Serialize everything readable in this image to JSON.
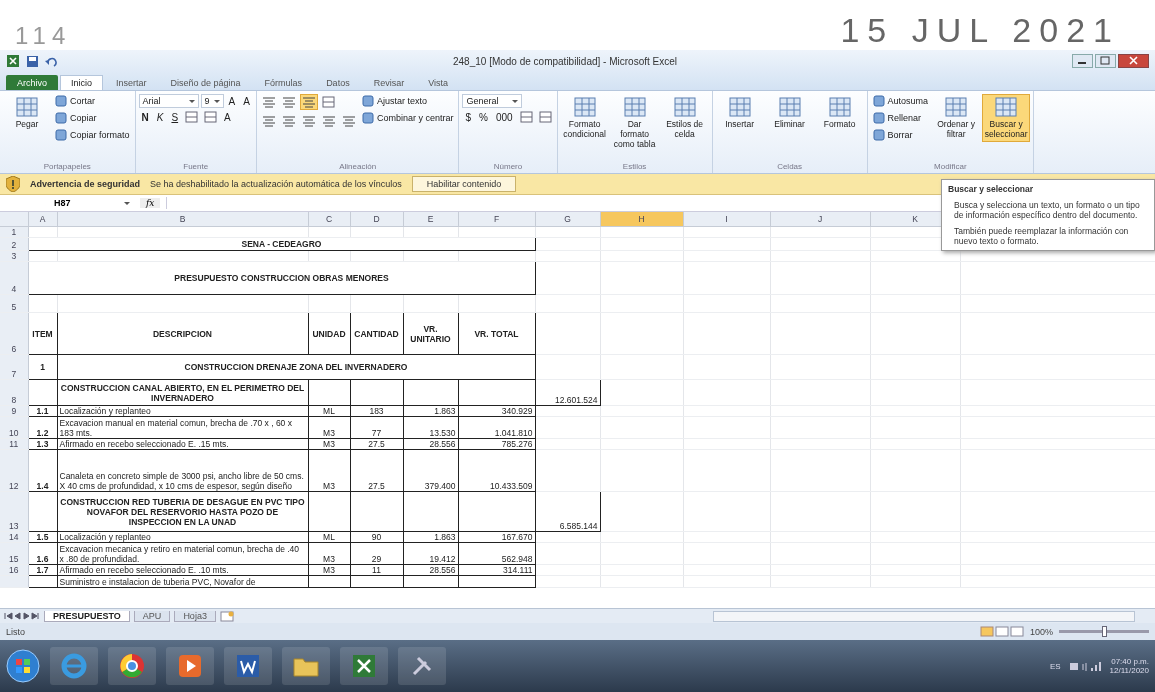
{
  "stamp": {
    "page_number": "114",
    "date": "15 JUL 2021"
  },
  "window": {
    "title": "248_10 [Modo de compatibilidad] - Microsoft Excel"
  },
  "ribbon_tabs": [
    {
      "label": "Archivo",
      "kind": "file",
      "selected": false
    },
    {
      "label": "Inicio",
      "kind": "tab",
      "selected": true
    },
    {
      "label": "Insertar",
      "kind": "tab",
      "selected": false
    },
    {
      "label": "Diseño de página",
      "kind": "tab",
      "selected": false
    },
    {
      "label": "Fórmulas",
      "kind": "tab",
      "selected": false
    },
    {
      "label": "Datos",
      "kind": "tab",
      "selected": false
    },
    {
      "label": "Revisar",
      "kind": "tab",
      "selected": false
    },
    {
      "label": "Vista",
      "kind": "tab",
      "selected": false
    }
  ],
  "ribbon_groups": [
    {
      "label": "Portapapeles",
      "columns": [
        [
          {
            "kind": "large",
            "label": "Pegar",
            "on": false
          }
        ],
        [
          {
            "kind": "small",
            "label": "Cortar"
          },
          {
            "kind": "small",
            "label": "Copiar"
          },
          {
            "kind": "small",
            "label": "Copiar formato"
          }
        ]
      ]
    },
    {
      "label": "Fuente",
      "columns": [
        [
          {
            "kind": "row",
            "items": [
              {
                "kind": "field",
                "label": "Arial"
              },
              {
                "kind": "field",
                "label": "9"
              },
              {
                "kind": "glyph",
                "label": "A"
              },
              {
                "kind": "glyph",
                "label": "A"
              }
            ]
          },
          {
            "kind": "row",
            "items": [
              {
                "kind": "bold",
                "label": "N"
              },
              {
                "kind": "italic",
                "label": "K"
              },
              {
                "kind": "underline",
                "label": "S"
              },
              {
                "kind": "icon"
              },
              {
                "kind": "icon"
              },
              {
                "kind": "glyph",
                "label": "A"
              }
            ]
          }
        ]
      ]
    },
    {
      "label": "Alineación",
      "columns": [
        [
          {
            "kind": "row",
            "items": [
              {
                "kind": "align",
                "on": false
              },
              {
                "kind": "align",
                "on": false
              },
              {
                "kind": "align",
                "on": true
              },
              {
                "kind": "icon"
              }
            ]
          },
          {
            "kind": "row",
            "items": [
              {
                "kind": "align",
                "on": false
              },
              {
                "kind": "align",
                "on": false
              },
              {
                "kind": "align",
                "on": false
              },
              {
                "kind": "align",
                "on": false
              },
              {
                "kind": "align",
                "on": false
              }
            ]
          }
        ],
        [
          {
            "kind": "small",
            "label": "Ajustar texto"
          },
          {
            "kind": "small",
            "label": "Combinar y centrar"
          }
        ]
      ]
    },
    {
      "label": "Número",
      "columns": [
        [
          {
            "kind": "row",
            "items": [
              {
                "kind": "field",
                "label": "General"
              }
            ]
          },
          {
            "kind": "row",
            "items": [
              {
                "kind": "glyph",
                "label": "$"
              },
              {
                "kind": "glyph",
                "label": "%"
              },
              {
                "kind": "glyph",
                "label": "000"
              },
              {
                "kind": "icon"
              },
              {
                "kind": "icon"
              }
            ]
          }
        ]
      ]
    },
    {
      "label": "Estilos",
      "columns": [
        [
          {
            "kind": "large",
            "label": "Formato condicional",
            "on": false
          }
        ],
        [
          {
            "kind": "large",
            "label": "Dar formato como tabla",
            "on": false
          }
        ],
        [
          {
            "kind": "large",
            "label": "Estilos de celda",
            "on": false
          }
        ]
      ]
    },
    {
      "label": "Celdas",
      "columns": [
        [
          {
            "kind": "large",
            "label": "Insertar",
            "on": false
          }
        ],
        [
          {
            "kind": "large",
            "label": "Eliminar",
            "on": false
          }
        ],
        [
          {
            "kind": "large",
            "label": "Formato",
            "on": false
          }
        ]
      ]
    },
    {
      "label": "Modificar",
      "columns": [
        [
          {
            "kind": "small",
            "label": "Autosuma"
          },
          {
            "kind": "small",
            "label": "Rellenar"
          },
          {
            "kind": "small",
            "label": "Borrar"
          }
        ],
        [
          {
            "kind": "large",
            "label": "Ordenar y filtrar",
            "on": false
          }
        ],
        [
          {
            "kind": "large",
            "label": "Buscar y seleccionar",
            "on": true
          }
        ]
      ]
    }
  ],
  "security_bar": {
    "title": "Advertencia de seguridad",
    "message": "Se ha deshabilitado la actualización automática de los vínculos",
    "button": "Habilitar contenido"
  },
  "formula_bar": {
    "name_box": "H87",
    "fx": "fx"
  },
  "tooltip": {
    "title": "Buscar y seleccionar",
    "paragraphs": [
      "Busca y selecciona un texto, un formato o un tipo de información específico dentro del documento.",
      "También puede reemplazar la información con nuevo texto o formato."
    ]
  },
  "columns": [
    {
      "label": "A",
      "selected": false
    },
    {
      "label": "B",
      "selected": false
    },
    {
      "label": "C",
      "selected": false
    },
    {
      "label": "D",
      "selected": false
    },
    {
      "label": "E",
      "selected": false
    },
    {
      "label": "F",
      "selected": false
    },
    {
      "label": "G",
      "selected": false
    },
    {
      "label": "H",
      "selected": true
    },
    {
      "label": "I",
      "selected": false
    },
    {
      "label": "J",
      "selected": false
    },
    {
      "label": "K",
      "selected": false
    }
  ],
  "rows": [
    {
      "number": "1",
      "kind": "empty"
    },
    {
      "number": "2",
      "kind": "title",
      "text": "SENA - CEDEAGRO"
    },
    {
      "number": "3",
      "kind": "empty"
    },
    {
      "number": "4",
      "kind": "title",
      "text": "PRESUPUESTO CONSTRUCCION OBRAS MENORES"
    },
    {
      "number": "5",
      "kind": "empty"
    },
    {
      "number": "6",
      "kind": "header",
      "cells": [
        "ITEM",
        "DESCRIPCION",
        "UNIDAD",
        "CANTIDAD",
        "VR. UNITARIO",
        "VR. TOTAL"
      ]
    },
    {
      "number": "7",
      "kind": "chapter",
      "item": "1",
      "text": "CONSTRUCCION DRENAJE ZONA DEL INVERNADERO"
    },
    {
      "number": "8",
      "kind": "section",
      "text": "CONSTRUCCION CANAL ABIERTO, EN EL PERIMETRO DEL INVERNADERO",
      "subtotal": "12.601.524"
    },
    {
      "number": "9",
      "kind": "line",
      "item": "1.1",
      "text": "Localización y replanteo",
      "unit": "ML",
      "qty": "183",
      "unit_price": "1.863",
      "total": "340.929"
    },
    {
      "number": "10",
      "kind": "line",
      "item": "1.2",
      "text": "Excavacion manual en material comun, brecha de .70 x , 60 x 183 mts.",
      "unit": "M3",
      "qty": "77",
      "unit_price": "13.530",
      "total": "1.041.810"
    },
    {
      "number": "11",
      "kind": "line",
      "item": "1.3",
      "text": "Afirmado en recebo seleccionado E. .15 mts.",
      "unit": "M3",
      "qty": "27.5",
      "unit_price": "28.556",
      "total": "785.276"
    },
    {
      "number": "12",
      "kind": "line",
      "item": "1.4",
      "text": "Canaleta en concreto simple de 3000 psi, ancho libre de 50 cms. X 40 cms de profundidad, x 10 cms de espesor, según diseño",
      "unit": "M3",
      "qty": "27.5",
      "unit_price": "379.400",
      "total": "10.433.509"
    },
    {
      "number": "13",
      "kind": "section",
      "text": "CONSTRUCCION RED TUBERIA DE DESAGUE EN PVC TIPO NOVAFOR DEL RESERVORIO HASTA POZO DE INSPECCION EN LA UNAD",
      "subtotal": "6.585.144"
    },
    {
      "number": "14",
      "kind": "line",
      "item": "1.5",
      "text": "Localización y replanteo",
      "unit": "ML",
      "qty": "90",
      "unit_price": "1.863",
      "total": "167.670"
    },
    {
      "number": "15",
      "kind": "line",
      "item": "1.6",
      "text": "Excavacion mecanica y retiro en material comun, brecha de .40 x .80 de profundidad.",
      "unit": "M3",
      "qty": "29",
      "unit_price": "19.412",
      "total": "562.948"
    },
    {
      "number": "16",
      "kind": "line",
      "item": "1.7",
      "text": "Afirmado en recebo seleccionado E. .10 mts.",
      "unit": "M3",
      "qty": "11",
      "unit_price": "28.556",
      "total": "314.111"
    },
    {
      "kind": "partial",
      "text": "Suministro e instalacion de tuberia PVC, Novafor de"
    }
  ],
  "sheet_tabs": [
    {
      "label": "PRESUPUESTO",
      "selected": true
    },
    {
      "label": "APU",
      "selected": false
    },
    {
      "label": "Hoja3",
      "selected": false
    }
  ],
  "status_bar": {
    "text": "Listo",
    "zoom": "100%",
    "level": 0.5
  },
  "taskbar": {
    "apps": [
      {
        "kind": "browser-e"
      },
      {
        "kind": "browser-ring"
      },
      {
        "kind": "media"
      },
      {
        "kind": "word"
      },
      {
        "kind": "folder"
      },
      {
        "kind": "excel"
      },
      {
        "kind": "tools"
      }
    ],
    "language": "ES",
    "time": "07:40 p.m.",
    "date": "12/11/2020"
  }
}
